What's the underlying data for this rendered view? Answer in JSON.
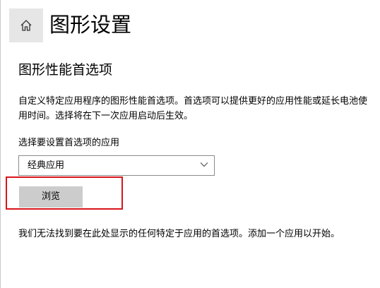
{
  "header": {
    "home_icon": "home-icon",
    "title": "图形设置"
  },
  "section": {
    "title": "图形性能首选项",
    "description": "自定义特定应用程序的图形性能首选项。首选项可以提供更好的应用性能或延长电池使用时间。选择将在下一次应用启动后生效。"
  },
  "app_picker": {
    "label": "选择要设置首选项的应用",
    "selected": "经典应用",
    "chevron_icon": "chevron-down-icon",
    "browse_label": "浏览"
  },
  "empty_state": {
    "message": "我们无法找到要在此处显示的任何特定于应用的首选项。添加一个应用以开始。"
  },
  "colors": {
    "highlight": "#d9141b",
    "button_bg": "#cccccc",
    "home_bg": "#e6e6e6"
  }
}
